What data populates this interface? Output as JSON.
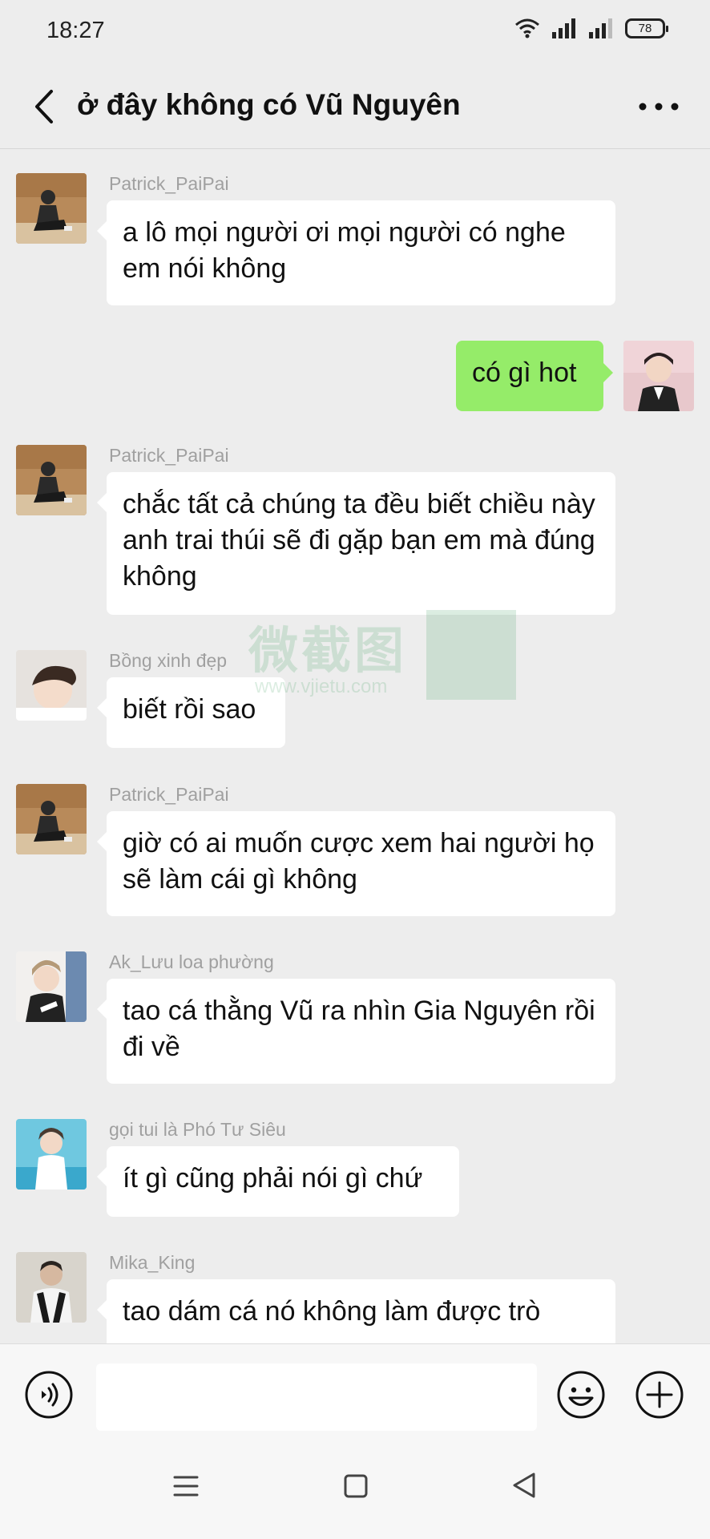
{
  "status_bar": {
    "time": "18:27",
    "battery": "78",
    "icons": [
      "wifi-icon",
      "signal-icon",
      "signal-icon",
      "battery-icon"
    ]
  },
  "header": {
    "title": "ở đây không có Vũ Nguyên",
    "back_icon": "chevron-left-icon",
    "more_icon": "more-dots-icon"
  },
  "messages": [
    {
      "direction": "in",
      "sender": "Patrick_PaiPai",
      "text": "a lô mọi người ơi mọi người có nghe em nói không"
    },
    {
      "direction": "out",
      "sender": "",
      "text": "có gì hot"
    },
    {
      "direction": "in",
      "sender": "Patrick_PaiPai",
      "text": "chắc tất cả chúng ta đều biết chiều này anh trai thúi sẽ đi gặp bạn em mà đúng không"
    },
    {
      "direction": "in",
      "sender": "Bồng xinh đẹp",
      "text": "biết rồi sao"
    },
    {
      "direction": "in",
      "sender": "Patrick_PaiPai",
      "text": "giờ có ai muốn cược xem hai người họ sẽ làm cái gì không"
    },
    {
      "direction": "in",
      "sender": "Ak_Lưu loa phường",
      "text": "tao cá thằng Vũ ra nhìn Gia Nguyên rồi đi về"
    },
    {
      "direction": "in",
      "sender": "gọi tui là Phó Tư Siêu",
      "text": "ít gì cũng phải nói gì chứ"
    },
    {
      "direction": "in",
      "sender": "Mika_King",
      "text": "tao dám cá nó không làm được trò"
    }
  ],
  "watermark": {
    "text": "微截图",
    "url": "www.vjietu.com"
  },
  "input_bar": {
    "placeholder": "",
    "voice_icon": "voice-icon",
    "emoji_icon": "emoji-icon",
    "plus_icon": "plus-icon"
  },
  "nav_bar": {
    "icons": [
      "menu-icon",
      "home-square-icon",
      "back-triangle-icon"
    ]
  },
  "colors": {
    "background": "#ededed",
    "outgoing_bubble": "#95ec69",
    "incoming_bubble": "#ffffff",
    "sender_name": "#a0a0a0"
  }
}
